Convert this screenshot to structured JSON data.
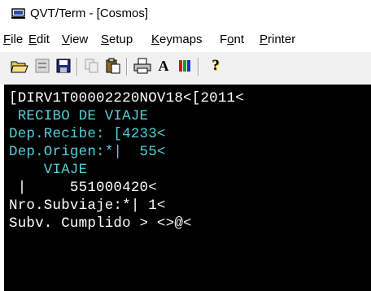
{
  "window": {
    "title": "QVT/Term - [Cosmos]"
  },
  "menu": {
    "items": [
      {
        "label": "File",
        "mnemonic": "F",
        "rest": "ile"
      },
      {
        "label": "Edit",
        "mnemonic": "E",
        "rest": "dit"
      },
      {
        "label": "View",
        "mnemonic": "V",
        "rest": "iew"
      },
      {
        "label": "Setup",
        "mnemonic": "S",
        "rest": "etup"
      },
      {
        "label": "Keymaps",
        "mnemonic": "K",
        "rest": "eymaps"
      },
      {
        "label": "Font",
        "pre": "F",
        "mnemonic": "o",
        "rest": "nt"
      },
      {
        "label": "Printer",
        "mnemonic": "P",
        "rest": "rinter"
      }
    ]
  },
  "toolbar": {
    "buttons": [
      {
        "name": "open-icon"
      },
      {
        "name": "close-session-icon"
      },
      {
        "name": "save-icon"
      },
      {
        "name": "copy-icon"
      },
      {
        "name": "paste-icon"
      },
      {
        "name": "print-icon"
      },
      {
        "name": "font-icon",
        "glyph": "A"
      },
      {
        "name": "colors-icon"
      },
      {
        "name": "help-icon",
        "glyph": "?"
      }
    ]
  },
  "terminal": {
    "colors": {
      "background": "#000000",
      "white": "#ffffff",
      "cyan": "#4fd1d9"
    },
    "lines": [
      {
        "text": "[DIRV1T00002220NOV18<[2011<",
        "color": "white"
      },
      {
        "text": " RECIBO DE VIAJE",
        "color": "cyan"
      },
      {
        "text": "Dep.Recibe: [4233<",
        "color": "cyan"
      },
      {
        "text": "Dep.Origen:*|  55<",
        "color": "cyan"
      },
      {
        "text": "    VIAJE",
        "color": "cyan"
      },
      {
        "text": " |     551000420<",
        "color": "white"
      },
      {
        "text": "Nro.Subviaje:*| 1<",
        "color": "white"
      },
      {
        "text": "Subv. Cumplido > <>@<",
        "color": "white"
      }
    ]
  }
}
